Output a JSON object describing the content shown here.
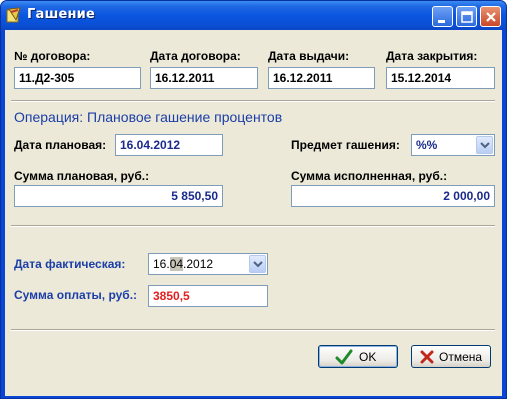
{
  "window": {
    "title": "Гашение"
  },
  "contract": {
    "number_label": "№ договора:",
    "number_value": "11.Д2-305",
    "date_label": "Дата договора:",
    "date_value": "16.12.2011",
    "issue_label": "Дата выдачи:",
    "issue_value": "16.12.2011",
    "close_label": "Дата закрытия:",
    "close_value": "15.12.2014"
  },
  "operation": {
    "prefix": "Операция:",
    "name": "Плановое гашение процентов",
    "planned_date_label": "Дата плановая:",
    "planned_date_value": "16.04.2012",
    "subject_label": "Предмет гашения:",
    "subject_value": "%%",
    "planned_sum_label": "Сумма плановая, руб.:",
    "planned_sum_value": "5 850,50",
    "executed_sum_label": "Сумма исполненная, руб.:",
    "executed_sum_value": "2 000,00"
  },
  "actual": {
    "date_label": "Дата фактическая:",
    "date_day": "16.",
    "date_month": "04",
    "date_year": ".2012",
    "payment_label": "Сумма оплаты, руб.:",
    "payment_value": "3850,5"
  },
  "buttons": {
    "ok": "OK",
    "cancel": "Отмена"
  },
  "colors": {
    "title_blue": "#0a56e0",
    "label_blue": "#1b3ea8",
    "payment_red": "#e02020",
    "amount_navy": "#1a2a8c"
  },
  "icons": [
    "app-icon",
    "minimize-icon",
    "maximize-icon",
    "close-icon",
    "chevron-down-icon",
    "checkmark-icon",
    "cross-icon"
  ]
}
